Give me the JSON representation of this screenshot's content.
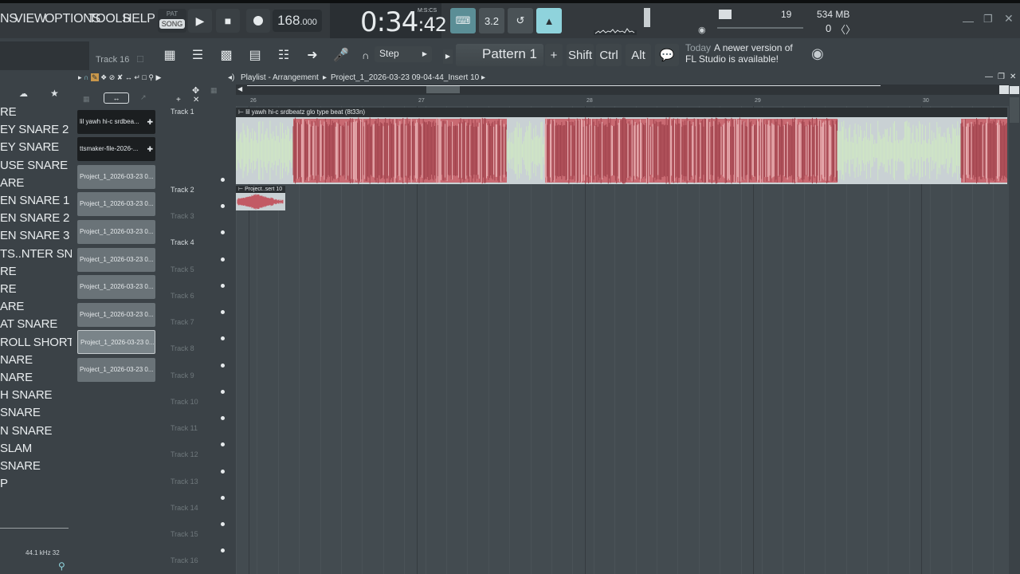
{
  "menu": {
    "items": [
      "NS",
      "VIEW",
      "OPTIONS",
      "TOOLS",
      "HELP"
    ]
  },
  "transport": {
    "pat_label": "PAT",
    "song_label": "SONG",
    "tempo_main": "168",
    "tempo_fraction": ".000",
    "time_main": "0:34",
    "time_cs": ":42",
    "time_format_label": "M:S:CS"
  },
  "status": {
    "cpu_value": "19",
    "memory": "534 MB",
    "polyphony": "0"
  },
  "toolbar2": {
    "track_label": "Track 16",
    "snap_label": "Step",
    "pattern_label": "Pattern 1",
    "add_pattern": "+",
    "shift_label": "Shift",
    "ctrl_label": "Ctrl",
    "alt_label": "Alt",
    "news_today": "Today",
    "news_text": "A newer version of FL Studio is available!"
  },
  "browser": {
    "items": [
      "RE",
      "EY SNARE 2",
      "EY SNARE",
      "USE SNARE",
      "ARE",
      "EN SNARE 1",
      "EN SNARE 2",
      "EN SNARE 3",
      "TS..NTER SNARE",
      "RE",
      "RE",
      "ARE",
      "AT SNARE",
      "ROLL SHORT",
      "NARE",
      "NARE",
      "H SNARE",
      "SNARE",
      "N SNARE",
      " SLAM",
      " SNARE",
      "P"
    ],
    "sample_rate": "44.1 kHz 32"
  },
  "picker": {
    "clips": [
      {
        "label": "lil yawh  hi-c  srdbea...",
        "style": "dark"
      },
      {
        "label": "ttsmaker-file-2026-...",
        "style": "dark"
      },
      {
        "label": "Project_1_2026-03-23 0...",
        "style": "light"
      },
      {
        "label": "Project_1_2026-03-23 0...",
        "style": "light"
      },
      {
        "label": "Project_1_2026-03-23 0...",
        "style": "light"
      },
      {
        "label": "Project_1_2026-03-23 0...",
        "style": "light"
      },
      {
        "label": "Project_1_2026-03-23 0...",
        "style": "light"
      },
      {
        "label": "Project_1_2026-03-23 0...",
        "style": "light"
      },
      {
        "label": "Project_1_2026-03-23 0...",
        "style": "selected"
      },
      {
        "label": "Project_1_2026-03-23 0...",
        "style": "light"
      }
    ]
  },
  "playlist": {
    "title": "Playlist - Arrangement",
    "breadcrumb": "Project_1_2026-03-23 09-04-44_Insert 10",
    "ruler": [
      "26",
      "27",
      "28",
      "29",
      "30"
    ],
    "tracks": [
      "Track 1",
      "Track 2",
      "Track 3",
      "Track 4",
      "Track 5",
      "Track 6",
      "Track 7",
      "Track 8",
      "Track 9",
      "Track 10",
      "Track 11",
      "Track 12",
      "Track 13",
      "Track 14",
      "Track 15",
      "Track 16"
    ],
    "clip1_title": "lil yawh  hi-c  srdbeatz glo type beat (8t33n)",
    "clip2_title": "Project..sert 10"
  },
  "colors": {
    "waveform_red": "#b7545d",
    "waveform_green": "#cfe6c4",
    "accent_cyan": "#8fd3dc"
  }
}
